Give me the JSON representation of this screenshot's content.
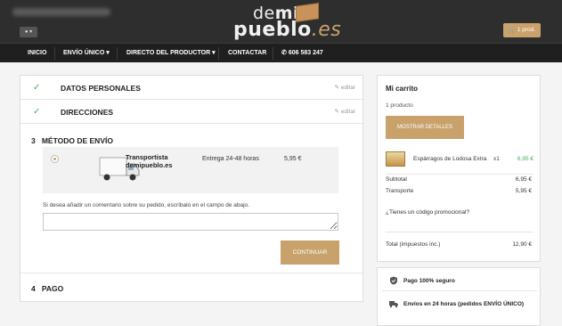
{
  "header": {
    "logo": {
      "top_light": "de",
      "top_bold": "mi",
      "bottom_main": "pueblo",
      "bottom_accent": ".es"
    },
    "user_menu_label": "▾",
    "cart_button_label": "1 prod."
  },
  "nav": {
    "items": [
      {
        "label": "INICIO"
      },
      {
        "label": "ENVÍO ÚNICO ▾"
      },
      {
        "label": "DIRECTO DEL PRODUCTOR ▾"
      },
      {
        "label": "CONTACTAR"
      },
      {
        "label": "606 583 247"
      }
    ]
  },
  "checkout": {
    "steps": [
      {
        "title": "DATOS PERSONALES",
        "edit": "editar",
        "status": "completed"
      },
      {
        "title": "DIRECCIONES",
        "edit": "editar",
        "status": "completed"
      },
      {
        "number": "3",
        "title": "MÉTODO DE ENVÍO",
        "status": "active"
      },
      {
        "number": "4",
        "title": "PAGO",
        "status": "pending"
      }
    ],
    "carrier": {
      "name": "Transportista demipueblo.es",
      "delay": "Entrega 24-48 horas",
      "price": "5,95 €",
      "selected": true
    },
    "comment_label": "Si desea añadir un comentario sobre su pedido, escríbalo en el campo de abajo.",
    "comment_value": "",
    "continue_label": "CONTINUAR"
  },
  "cart": {
    "title": "Mi carrito",
    "count": "1 producto",
    "details_button": "MOSTRAR DETALLES",
    "product": {
      "name": "Espárragos de Lodosa Extra",
      "qty": "x1",
      "price": "6,95 €"
    },
    "subtotal_label": "Subtotal",
    "subtotal_value": "6,95 €",
    "shipping_label": "Transporte",
    "shipping_value": "5,95 €",
    "promo_label": "¿Tienes un código promocional?",
    "total_label": "Total (impuestos inc.)",
    "total_value": "12,90 €"
  },
  "reassurance": [
    {
      "icon": "shield-check-icon",
      "text": "Pago 100% seguro"
    },
    {
      "icon": "truck-icon",
      "text": "Envíos en 24 horas (pedidos ENVÍO ÚNICO)"
    }
  ],
  "colors": {
    "header_bg": "#2e2e2e",
    "nav_bg": "#1f1f1f",
    "accent": "#c9a26b",
    "check_green": "#3fae5a",
    "price_green": "#3fae5a"
  }
}
